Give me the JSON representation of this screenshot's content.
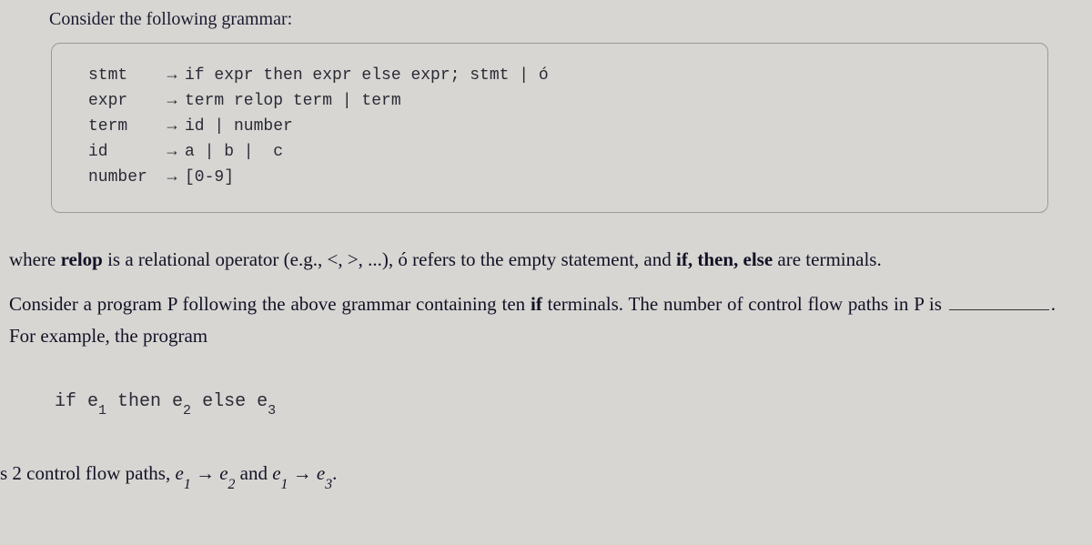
{
  "intro": "Consider the following grammar:",
  "grammar": [
    {
      "lhs": "stmt",
      "rhs": "if expr then expr else expr; stmt | ó"
    },
    {
      "lhs": "expr",
      "rhs": "term relop term | term"
    },
    {
      "lhs": "term",
      "rhs": "id | number"
    },
    {
      "lhs": "id",
      "rhs": "a | b |  c"
    },
    {
      "lhs": "number",
      "rhs": "[0-9]"
    }
  ],
  "arrow": "→",
  "where_pre": "where ",
  "relop": "relop",
  "where_mid": " is a relational operator (e.g., <, >, ...), ó refers to the empty statement, and ",
  "if": "if",
  "then": ", then",
  "else": ", else",
  "where_post": " are terminals.",
  "consider_pre": "Consider a program P following the above grammar containing ten ",
  "consider_if": "if",
  "consider_mid": " terminals. The number of control flow paths in P is ",
  "consider_post": ". For example, the program",
  "example": {
    "if": "if e",
    "s1": "1",
    "then": " then e",
    "s2": "2",
    "else": " else e",
    "s3": "3"
  },
  "footer": {
    "lead": "s 2 control flow paths, ",
    "e1a": "e",
    "sub1a": "1",
    "arrow2": " → ",
    "e2a": "e",
    "sub2a": "2",
    "and": " and ",
    "e1b": "e",
    "sub1b": "1",
    "arrow3": " → ",
    "e3b": "e",
    "sub3b": "3",
    "dot": "."
  }
}
